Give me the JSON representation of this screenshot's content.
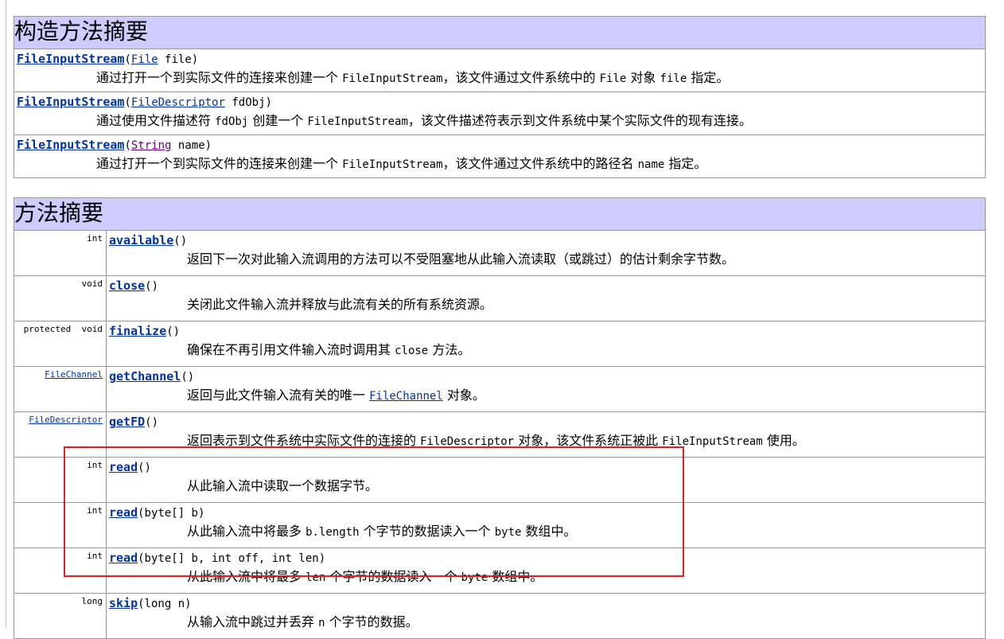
{
  "constructor_summary": {
    "title": "构造方法摘要",
    "rows": [
      {
        "name": "FileInputStream",
        "open": "(",
        "param_type": "File",
        "param_rest": " file)",
        "desc_parts": [
          "通过打开一个到实际文件的连接来创建一个 ",
          "FileInputStream",
          "，该文件通过文件系统中的 ",
          "File",
          " 对象 ",
          "file",
          " 指定。"
        ]
      },
      {
        "name": "FileInputStream",
        "open": "(",
        "param_type": "FileDescriptor",
        "param_rest": " fdObj)",
        "desc_parts": [
          "通过使用文件描述符 ",
          "fdObj",
          " 创建一个 ",
          "FileInputStream",
          "，该文件描述符表示到文件系统中某个实际文件的现有连接。"
        ]
      },
      {
        "name": "FileInputStream",
        "open": "(",
        "param_type": "String",
        "param_rest": " name)",
        "desc_parts": [
          "通过打开一个到实际文件的连接来创建一个 ",
          "FileInputStream",
          "，该文件通过文件系统中的路径名 ",
          "name",
          " 指定。"
        ]
      }
    ]
  },
  "method_summary": {
    "title": "方法摘要",
    "rows": [
      {
        "type": "int",
        "name": "available",
        "params": "()",
        "desc_parts": [
          "返回下一次对此输入流调用的方法可以不受阻塞地从此输入流读取（或跳过）的估计剩余字节数。"
        ]
      },
      {
        "type": "void",
        "name": "close",
        "params": "()",
        "desc_parts": [
          "关闭此文件输入流并释放与此流有关的所有系统资源。"
        ]
      },
      {
        "type": "protected  void",
        "name": "finalize",
        "params": "()",
        "desc_parts": [
          "确保在不再引用文件输入流时调用其 ",
          "close",
          " 方法。"
        ]
      },
      {
        "type": "FileChannel",
        "name": "getChannel",
        "params": "()",
        "desc_parts": [
          "返回与此文件输入流有关的唯一 ",
          "FileChannel",
          " 对象。"
        ]
      },
      {
        "type": "FileDescriptor",
        "name": "getFD",
        "params": "()",
        "desc_parts": [
          "返回表示到文件系统中实际文件的连接的 ",
          "FileDescriptor",
          " 对象，该文件系统正被此 ",
          "FileInputStream",
          " 使用。"
        ]
      },
      {
        "type": "int",
        "name": "read",
        "params": "()",
        "desc_parts": [
          "从此输入流中读取一个数据字节。"
        ]
      },
      {
        "type": "int",
        "name": "read",
        "params": "(byte[] b)",
        "desc_parts": [
          "从此输入流中将最多 ",
          "b.length",
          " 个字节的数据读入一个 ",
          "byte",
          " 数组中。"
        ]
      },
      {
        "type": "int",
        "name": "read",
        "params": "(byte[] b, int off, int len)",
        "desc_parts": [
          "从此输入流中将最多 ",
          "len",
          " 个字节的数据读入一个 ",
          "byte",
          " 数组中。"
        ]
      },
      {
        "type": "long",
        "name": "skip",
        "params": "(long n)",
        "desc_parts": [
          "从输入流中跳过并丢弃 ",
          "n",
          " 个字节的数据。"
        ]
      }
    ]
  },
  "colors": {
    "header_bg": "#ccccff",
    "link": "#0033aa",
    "highlight_border": "#e02020"
  }
}
